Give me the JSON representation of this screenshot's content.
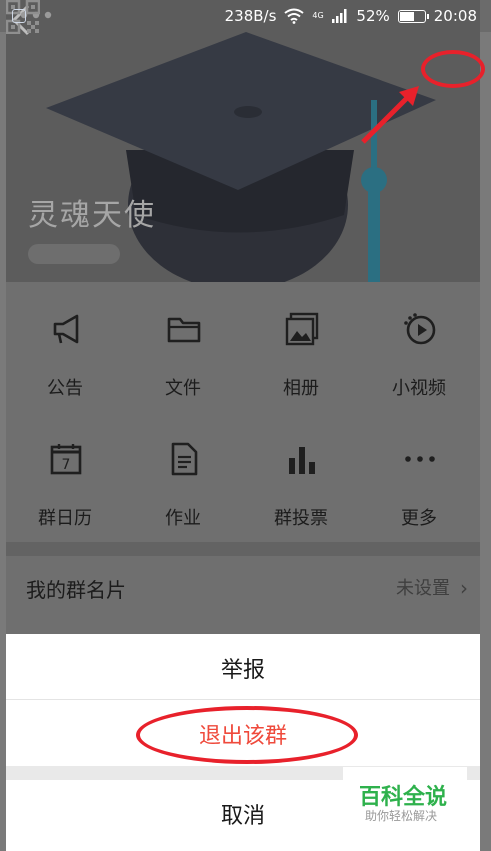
{
  "status_bar": {
    "speed": "238B/s",
    "network": "4G",
    "battery": "52%",
    "time": "20:08"
  },
  "header": {
    "group_name": "灵魂天使"
  },
  "functions": [
    {
      "label": "公告",
      "icon": "megaphone-icon"
    },
    {
      "label": "文件",
      "icon": "folder-icon"
    },
    {
      "label": "相册",
      "icon": "photo-album-icon"
    },
    {
      "label": "小视频",
      "icon": "video-icon"
    },
    {
      "label": "群日历",
      "icon": "calendar-icon"
    },
    {
      "label": "作业",
      "icon": "document-icon"
    },
    {
      "label": "群投票",
      "icon": "bar-chart-icon"
    },
    {
      "label": "更多",
      "icon": "more-dots-icon"
    }
  ],
  "name_card": {
    "title": "我的群名片",
    "value": "未设置"
  },
  "sheet": {
    "report": "举报",
    "quit": "退出该群",
    "cancel": "取消"
  },
  "watermark": {
    "title": "百科全说",
    "subtitle": "助你轻松解决"
  },
  "colors": {
    "danger": "#ef4a3c",
    "annotation": "#e8212b",
    "watermark_green": "#2eb14c"
  }
}
